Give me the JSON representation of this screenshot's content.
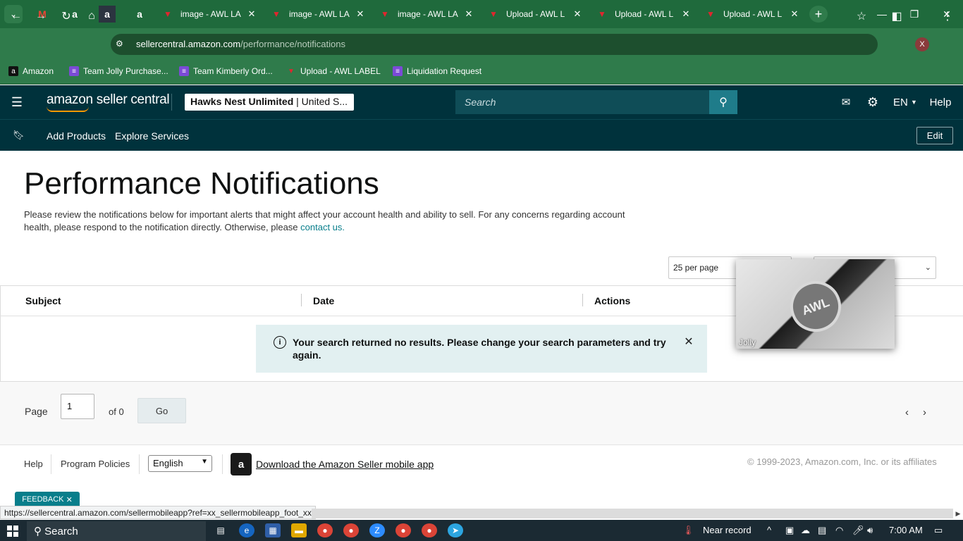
{
  "browser": {
    "tabs_pinned": [
      "a",
      "a",
      "a"
    ],
    "tabs": [
      {
        "title": "image - AWL LA"
      },
      {
        "title": "image - AWL LA"
      },
      {
        "title": "image - AWL LA"
      },
      {
        "title": "Upload - AWL L"
      },
      {
        "title": "Upload - AWL L"
      },
      {
        "title": "Upload - AWL L"
      }
    ],
    "new_tab": "+",
    "url_host": "sellercentral.amazon.com",
    "url_path": "/performance/notifications",
    "profile_initial": "X",
    "bookmarks": [
      {
        "label": "Amazon"
      },
      {
        "label": "Team Jolly Purchase..."
      },
      {
        "label": "Team Kimberly Ord..."
      },
      {
        "label": "Upload - AWL LABEL"
      },
      {
        "label": "Liquidation Request"
      }
    ]
  },
  "seller_central": {
    "logo_text": "amazon seller central",
    "store_name": "Hawks Nest Unlimited",
    "store_region": "| United S...",
    "search_placeholder": "Search",
    "language": "EN",
    "help": "Help",
    "nav": {
      "add_products": "Add Products",
      "explore_services": "Explore Services",
      "edit": "Edit"
    }
  },
  "page": {
    "title": "Performance Notifications",
    "intro": "Please review the notifications below for important alerts that might affect your account health and ability to sell. For any concerns regarding account health, please respond to the notification directly. Otherwise, please ",
    "contact_link": "contact us.",
    "per_page": "25 per page",
    "columns": [
      "Subject",
      "Date",
      "Actions"
    ],
    "alert": "Your search returned no results. Please change your search parameters and try again.",
    "pagination": {
      "page_label": "Page",
      "page_value": "1",
      "of_label": "of 0",
      "go": "Go"
    }
  },
  "footer": {
    "help": "Help",
    "program_policies": "Program Policies",
    "language": "English",
    "app_link": "Download the Amazon Seller mobile app",
    "copyright": "© 1999-2023, Amazon.com, Inc. or its affiliates"
  },
  "feedback": "FEEDBACK",
  "status_url": "https://sellercentral.amazon.com/sellermobileapp?ref=xx_sellermobileapp_foot_xx",
  "pip": {
    "label": "Jolly",
    "badge": "AWL"
  },
  "taskbar": {
    "search": "Search",
    "weather": "Near record",
    "time": "7:00 AM"
  },
  "colors": {
    "browser_green": "#1f6a3c",
    "seller_header": "#00323c",
    "accent_teal": "#087e8b",
    "alert_bg": "#e2f0f1"
  }
}
